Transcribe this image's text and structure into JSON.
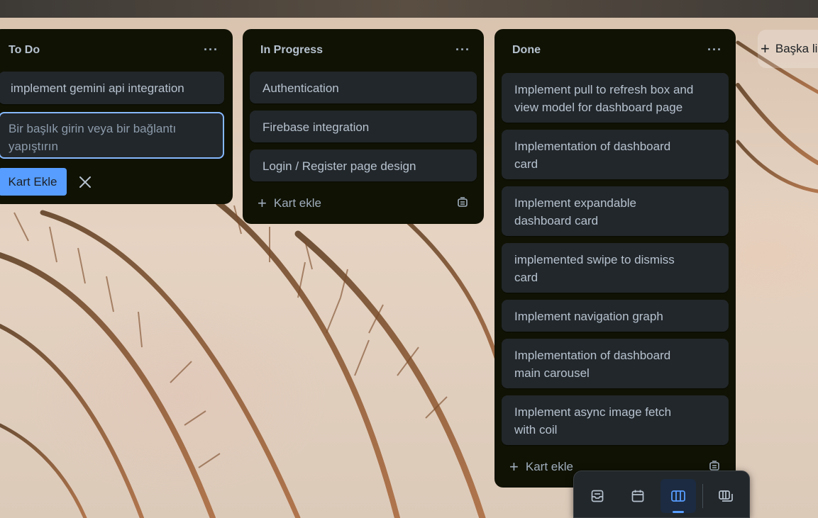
{
  "lists": [
    {
      "title": "To Do",
      "cards": [
        "implement gemini api integration"
      ],
      "composer": {
        "placeholder": "Bir başlık girin veya bir bağlantı yapıştırın",
        "add_button": "Kart Ekle"
      }
    },
    {
      "title": "In Progress",
      "cards": [
        "Authentication",
        "Firebase integration",
        "Login / Register page design"
      ],
      "add_card": "Kart ekle"
    },
    {
      "title": "Done",
      "cards": [
        "Implement pull to refresh box and view model for dashboard page",
        "Implementation of dashboard card",
        "Implement expandable dashboard card",
        "implemented swipe to dismiss card",
        "Implement navigation graph",
        "Implementation of dashboard main carousel",
        "Implement async image fetch with coil"
      ],
      "add_card": "Kart ekle"
    }
  ],
  "add_list": "Başka li",
  "colors": {
    "list_bg": "#101204",
    "card_bg": "#22272b",
    "accent": "#579dff",
    "text": "#b6c2cf"
  },
  "toolbar": {
    "items": [
      "inbox-icon",
      "calendar-icon",
      "board-icon",
      "switch-boards-icon"
    ],
    "active": "board-icon"
  }
}
